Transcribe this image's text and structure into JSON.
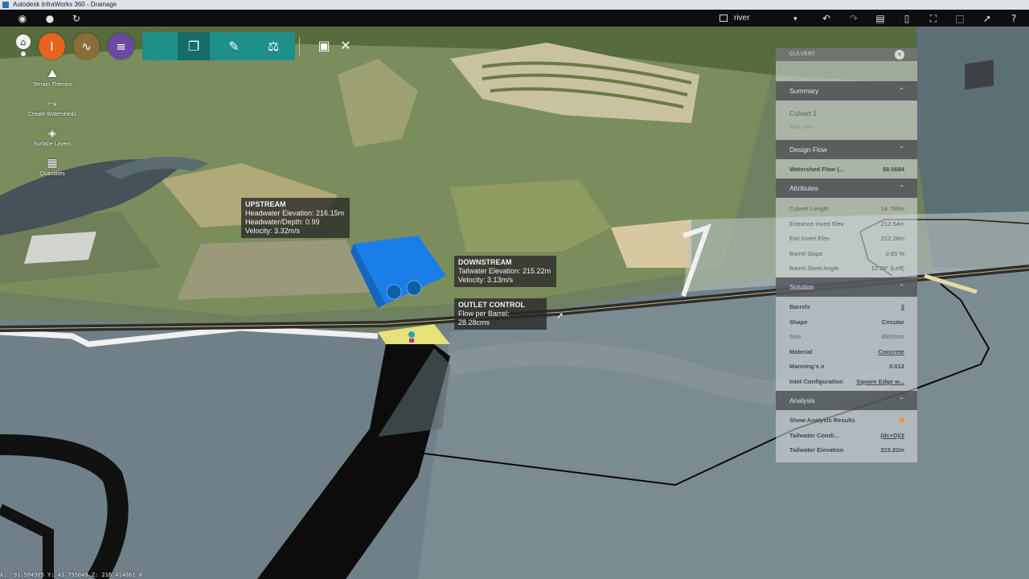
{
  "window": {
    "title": "Autodesk InfraWorks 360 - Drainage"
  },
  "topbar": {
    "account_icon": "account-circle-icon",
    "scenario": {
      "label": "river",
      "caret": "▾"
    }
  },
  "tools": {
    "home_icon": "⌂",
    "circles": [
      "I",
      "∿",
      "≡",
      "◡"
    ],
    "squares": [
      "❐",
      "✎",
      "⚖"
    ],
    "right": [
      "▣",
      "✕"
    ]
  },
  "side_tools": [
    {
      "icon": "⛰",
      "label": "Terrain Themes"
    },
    {
      "icon": "⤳",
      "label": "Create Watersheds"
    },
    {
      "icon": "◈",
      "label": "Surface Layers"
    },
    {
      "icon": "▦",
      "label": "Quantities"
    }
  ],
  "callouts": {
    "upstream": {
      "title": "UPSTREAM",
      "headwater_elevation": "Headwater Elevation: 216.15m",
      "headwater_depth": "Headwater/Depth: 0.99",
      "velocity": "Velocity: 3.32m/s"
    },
    "downstream": {
      "title": "DOWNSTREAM",
      "tailwater_elevation": "Tailwater Elevation: 215.22m",
      "velocity": "Velocity: 3.13m/s"
    },
    "outlet": {
      "title": "OUTLET CONTROL",
      "flow": "Flow per Barrel: 28.28cms"
    }
  },
  "panel": {
    "header": "CULVERT",
    "close": "×",
    "sections": {
      "summary": "Summary",
      "design_flow": "Design Flow",
      "attributes": "Attributes",
      "solution": "Solution",
      "analysis": "Analysis"
    },
    "summary": {
      "name": "Culvert 1",
      "note": "Add note"
    },
    "design_flow": {
      "label": "Watershed Flow (...",
      "value": "58.5684"
    },
    "attributes": [
      {
        "label": "Culvert Length",
        "value": "14.790m"
      },
      {
        "label": "Entrance Invert Elev",
        "value": "212.54m"
      },
      {
        "label": "Exit Invert Elev",
        "value": "212.28m"
      },
      {
        "label": "Barrel Slope",
        "value": "0.85 %"
      },
      {
        "label": "Barrel Skew Angle",
        "value": "12.39° (Left)"
      }
    ],
    "solution": [
      {
        "label": "Barrels",
        "value": "2"
      },
      {
        "label": "Shape",
        "value": "Circular"
      },
      {
        "label": "Size",
        "value": "3600mm"
      },
      {
        "label": "Material",
        "value": "Concrete"
      },
      {
        "label": "Manning's n",
        "value": "0.012"
      },
      {
        "label": "Inlet Configuration",
        "value": "Square Edge w..."
      }
    ],
    "analysis": [
      {
        "label": "Show Analysis Results",
        "value": ""
      },
      {
        "label": "Tailwater Condi...",
        "value": "(dc+D)/2"
      },
      {
        "label": "Tailwater Elevation",
        "value": "215.22m"
      }
    ]
  },
  "status": {
    "coordinates": "X: -91.594905 Y: 43.795049 Z: 216.414861 m"
  },
  "colors": {
    "teal": "#1f8f8a",
    "orange": "#e8641e",
    "brown": "#8a6e3a",
    "purple": "#6a4aa0",
    "panel_header": "#3c3e42"
  }
}
